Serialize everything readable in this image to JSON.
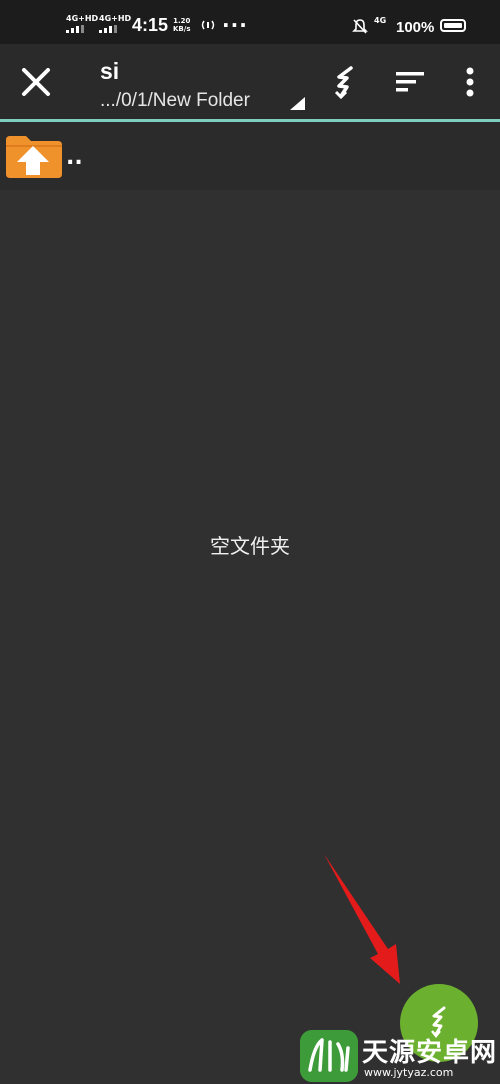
{
  "status_bar": {
    "signal_1": "4G+HD",
    "signal_2": "4G+HD",
    "time": "4:15",
    "speed_value": "1.20",
    "speed_unit": "KB/s",
    "more": "···",
    "network": "4G",
    "battery_text": "100%",
    "battery_level": 1.0
  },
  "toolbar": {
    "title": "si",
    "path": ".../0/1/New Folder",
    "close_icon": "close-icon",
    "download_icon": "download-icon",
    "sort_icon": "sort-icon",
    "more_icon": "more-vertical-icon"
  },
  "list": {
    "parent_label": "..",
    "parent_icon": "folder-up-icon"
  },
  "empty_message": "空文件夹",
  "fab": {
    "icon": "download-icon",
    "color": "#6bb02e"
  },
  "watermark": {
    "title": "天源安卓网",
    "url": "www.jytyaz.com"
  },
  "colors": {
    "accent_line": "#7ecfc0",
    "folder": "#f0922b",
    "annotation_arrow": "#e31b1b"
  }
}
